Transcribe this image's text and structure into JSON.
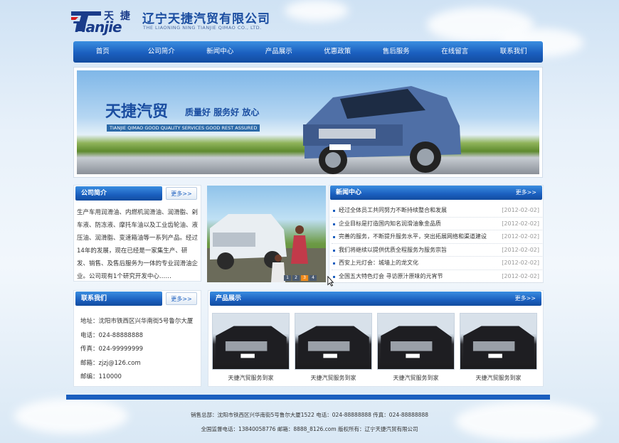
{
  "header": {
    "logo_cn": "天 捷",
    "logo_en": "Tianjie",
    "company_cn": "辽宁天捷汽贸有限公司",
    "company_en": "THE LIAONING NING TIANJIE QIMAO CO., LTD."
  },
  "nav": {
    "items": [
      "首页",
      "公司简介",
      "新闻中心",
      "产品展示",
      "优惠政策",
      "售后服务",
      "在线留言",
      "联系我们"
    ]
  },
  "banner": {
    "title": "天捷汽贸",
    "slogan": "质量好 服务好 放心",
    "english": "TIANJIE QIMAO GOOD QUALITY SERVICES GOOD REST ASSURED"
  },
  "intro": {
    "title": "公司简介",
    "more": "更多>>",
    "text": "生产车用润滑油、内燃机润滑油、润滑脂、剁车液、防冻液、摩托车油以及工业齿轮油、液压油、润滑脂、变速箱油等一系列产品。经过14年的发展，现在已经是一家集生产、研发、销售、及售后服务为一体的专业润滑油企业。公司现有1个研究开发中心……"
  },
  "photo": {
    "dots": [
      "1",
      "2",
      "3",
      "4"
    ],
    "active_dot": 2
  },
  "news": {
    "title": "新闻中心",
    "more": "更多>>",
    "items": [
      {
        "title": "经过全体员工共同努力不断持续整合和发展",
        "date": "[2012-02-02]"
      },
      {
        "title": "企业目标是打造国内知名润滑油象金品质",
        "date": "[2012-02-02]"
      },
      {
        "title": "完善的服务，不断提升服务水平，突出拓展网络和渠道建设",
        "date": "[2012-02-02]"
      },
      {
        "title": "我们将继续以提供优质全程服务为服务宗旨",
        "date": "[2012-02-02]"
      },
      {
        "title": "西安上元灯会：城墙上的龙文化",
        "date": "[2012-02-02]"
      },
      {
        "title": "全国五大特色灯会 寻访原汁原味的元宵节",
        "date": "[2012-02-02]"
      }
    ]
  },
  "contact": {
    "title": "联系我们",
    "more": "更多>>",
    "lines": [
      "地址：沈阳市铁西区兴华南街5号鲁尔大厦",
      "电话：024-88888888",
      "传真：024-99999999",
      "邮箱：zjzj@126.com",
      "邮编：110000"
    ]
  },
  "products": {
    "title": "产品展示",
    "more": "更多>>",
    "items": [
      {
        "caption": "天捷汽贸服务到家"
      },
      {
        "caption": "天捷汽贸服务到家"
      },
      {
        "caption": "天捷汽贸服务到家"
      },
      {
        "caption": "天捷汽贸服务到家"
      }
    ]
  },
  "footer": {
    "line1": "销售总部：沈阳市铁西区兴华南街5号鲁尔大厦1522 电话：024-88888888 传真：024-88888888",
    "line2": "全国监督电话：13840058776 邮箱：8888_8126.com 版权所有：辽宁天捷汽贸有限公司"
  },
  "colors": {
    "brand_blue": "#1b5fbf",
    "nav_gradient_top": "#3a8ee0",
    "accent_orange": "#f08a1a"
  }
}
